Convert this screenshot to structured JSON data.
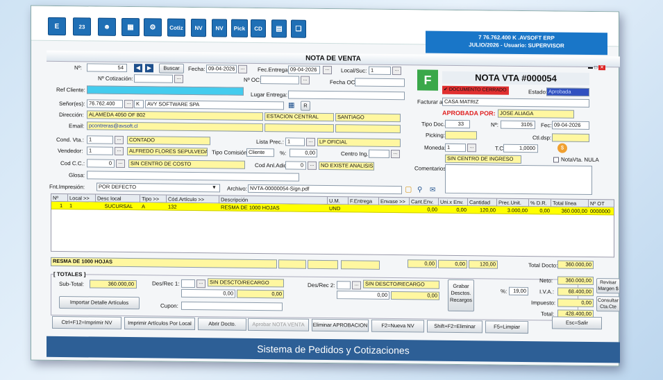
{
  "toolbar": {
    "btn_e": "E",
    "btn_cal": "23",
    "btn_cotiz": "Cotiz",
    "btn_nv1": "NV",
    "btn_nv2": "NV",
    "btn_pick": "Pick",
    "btn_cd": "CD"
  },
  "info": {
    "line1": "7 76.762.400 K .AVSOFT ERP",
    "line2": "JULIO/2026 - Usuario: SUPERVISOR"
  },
  "window": {
    "title": "NOTA DE VENTA"
  },
  "form": {
    "n_label": "Nº:",
    "n_value": "54",
    "buscar": "Buscar",
    "fecha_label": "Fecha:",
    "fecha": "09-04-2026",
    "fecha_entrega_label": "Fec.Entrega:",
    "fecha_entrega": "09-04-2026",
    "local_label": "Local/Suc:",
    "local": "1",
    "cotiz_label": "Nº Cotización:",
    "oc_label": "Nº OC:",
    "fecha_oc_label": "Fecha OC:",
    "ref_cliente_label": "Ref Cliente:",
    "lugar_entrega_label": "Lugar Entrega:",
    "senor_label": "Señor(es):",
    "rut": "76.762.400",
    "dv": "K",
    "cliente": "AVY SOFTWARE SPA",
    "r_btn": "R",
    "direccion_label": "Dirección:",
    "direccion": "ALAMEDA 4050 OF 802",
    "comuna": "ESTACION CENTRAL",
    "ciudad": "SANTIAGO",
    "email_label": "Email:",
    "email": "pcontreras@avsoft.cl",
    "cond_label": "Cond. Vta.:",
    "cond_code": "1",
    "cond": "CONTADO",
    "lista_label": "Lista Prec.:",
    "lista_code": "1",
    "lista": "LP OFICIAL",
    "vendedor_label": "Vendedor:",
    "vendedor_code": "1",
    "vendedor": "ALFREDO FLORES SEPULVEDA",
    "tipo_comision_label": "Tipo Comisión:",
    "tipo_comision": "Cliente",
    "pct_label": "%:",
    "pct": "0,00",
    "centro_label": "Centro Ing.:",
    "codcc_label": "Cod C.C.:",
    "codcc": "0",
    "codcc_name": "SIN CENTRO DE COSTO",
    "codanl_label": "Cod Anl.Adic:",
    "codanl": "0",
    "codanl_name": "NO EXISTE ANALISIS",
    "glosa_label": "Glosa:",
    "fnt_label": "Fnt.Impresión:",
    "fnt": "POR DEFECTO",
    "archivo_label": "Archivo:",
    "archivo": "NVTA-00000054-Sign.pdf"
  },
  "right": {
    "f_badge": "F",
    "nota_title": "NOTA VTA #000054",
    "cerrado": "DOCUMENTO CERRADO",
    "estado_label": "Estado:",
    "estado": "Aprobada",
    "factura_label": "Facturar a:",
    "factura": "CASA MATRIZ",
    "aprobada_label": "APROBADA POR:",
    "aprobada": "JOSE ALIAGA",
    "tipodoc_label": "Tipo Doc.:",
    "tipodoc": "33",
    "n_label": "Nº:",
    "n": "3105",
    "fec_label": "Fec:",
    "fec": "09-04-2026",
    "picking_label": "Picking:",
    "ctldsp_label": "Ctl.dsp:",
    "moneda_label": "Moneda:",
    "moneda": "1",
    "tc_label": "T.C:",
    "tc": "1,0000",
    "centro_ingreso": "SIN CENTRO DE INGRESO",
    "notavta_nula": "NotaVta. NULA",
    "comentarios_label": "Comentarios:"
  },
  "grid": {
    "headers": [
      "Nº",
      "Local >>",
      "Desc local",
      "Tipo >>",
      "Cód.Artículo >>",
      "Descripción",
      "U.M.",
      "F.Entrega",
      "Envase >>",
      "Cant.Env.",
      "Uni.x Env.",
      "Cantidad",
      "Prec.Unit.",
      "% D.R.",
      "Total línea",
      "Nº OT"
    ],
    "rows": [
      [
        "1",
        "1",
        "SUCURSAL",
        "A",
        "132",
        "RESMA DE 1000 HOJAS",
        "UND",
        "",
        "",
        "0,00",
        "0,00",
        "120,00",
        "3.000,00",
        "0,00",
        "360.000,00",
        "0000000"
      ]
    ]
  },
  "summary": {
    "desc": "RESMA DE 1000 HOJAS",
    "cant_env": "0,00",
    "uni_env": "0,00",
    "cantidad": "120,00",
    "total_docto_label": "Total Docto:",
    "total_docto": "360.000,00"
  },
  "totales": {
    "title": "[ TOTALES ]",
    "subtotal_label": "Sub-Total:",
    "subtotal": "360.000,00",
    "importar": "Importar Detalle Artículos",
    "desrec1_label": "Des/Rec 1:",
    "desrec1": "SIN DESCTO/RECARGO",
    "desrec1_v1": "0,00",
    "desrec1_v2": "0,00",
    "cupon_label": "Cupon:",
    "desrec2_label": "Des/Rec 2:",
    "desrec2": "SIN DESCTO/RECARGO",
    "desrec2_v1": "0,00",
    "desrec2_v2": "0,00",
    "grabar": "Grabar Desctos. Recargos",
    "neto_label": "Neto:",
    "neto": "360.000,00",
    "pct_label": "%:",
    "pct": "19,00",
    "iva_label": "I.V.A.:",
    "iva": "68.400,00",
    "impuesto_label": "Impuesto:",
    "impuesto": "0,00",
    "total_label": "Total:",
    "total": "428.400,00",
    "revisar": "Revisar Margen $",
    "consultar": "Consultar Cta.Cte"
  },
  "bottom": {
    "b1": "Ctrl+F12=Imprimir NV",
    "b2": "Imprimir Artículos Por Local",
    "b3": "Abrir Docto.",
    "b4": "Aprobar NOTA VENTA",
    "b5": "Eliminar APROBACION",
    "b6": "F2=Nueva NV",
    "b7": "Shift+F2=Eliminar",
    "b8": "F5=Limpiar",
    "b9": "Esc=Salir"
  },
  "footer": {
    "text": "Sistema de Pedidos y Cotizaciones"
  }
}
